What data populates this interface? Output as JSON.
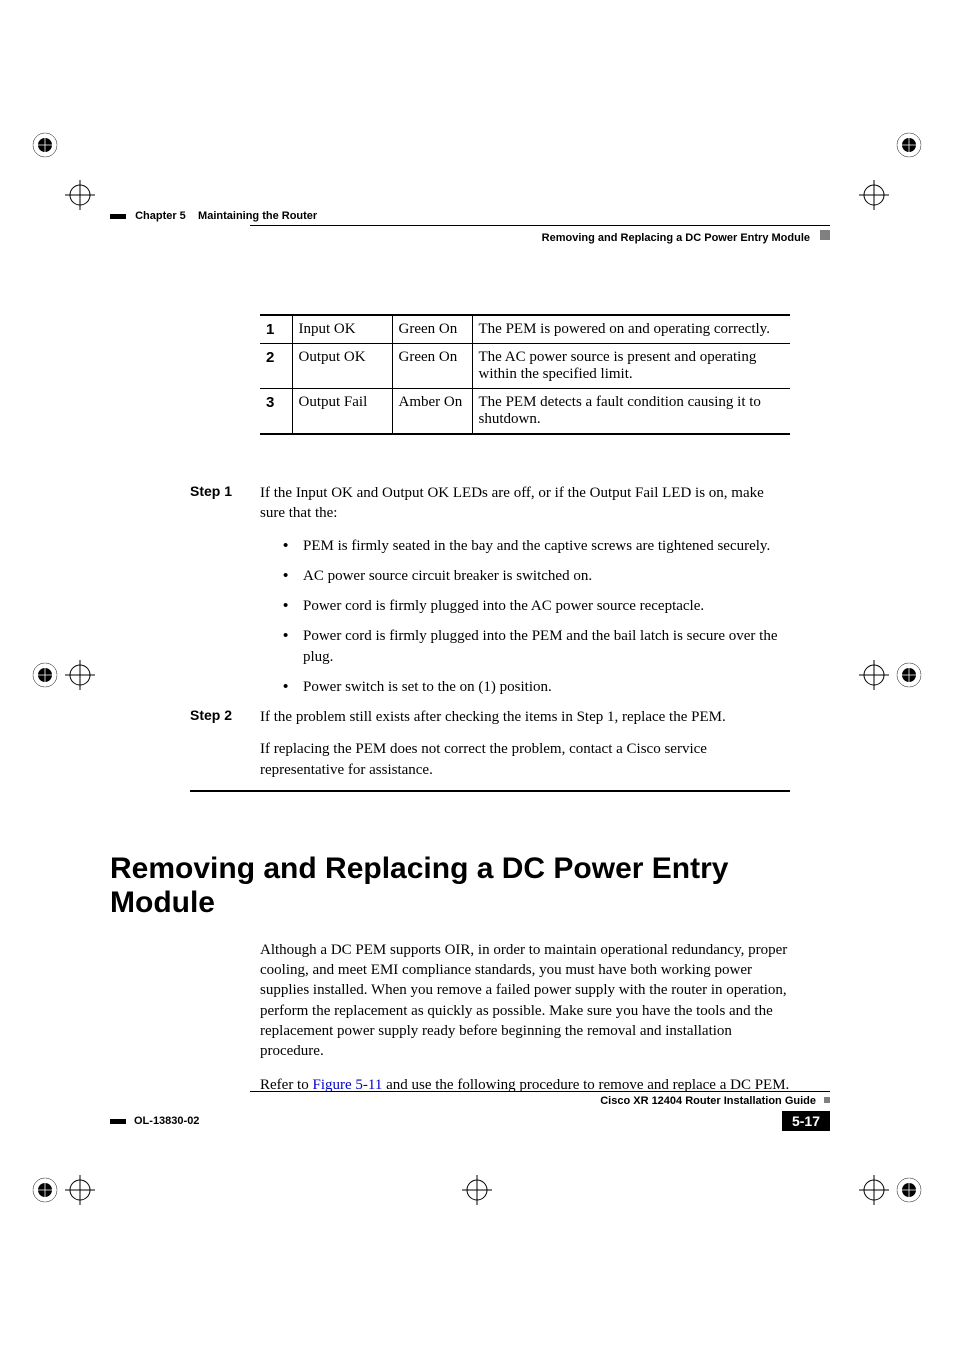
{
  "header": {
    "chapter": "Chapter 5",
    "chapter_title": "Maintaining the Router",
    "section_title": "Removing and Replacing a DC Power Entry Module"
  },
  "table": {
    "rows": [
      {
        "num": "1",
        "name": "Input OK",
        "led": "Green On",
        "desc": "The PEM is powered on and operating correctly."
      },
      {
        "num": "2",
        "name": "Output OK",
        "led": "Green On",
        "desc": "The AC power source is present and operating within the specified limit."
      },
      {
        "num": "3",
        "name": "Output Fail",
        "led": "Amber On",
        "desc": "The PEM detects a fault condition causing it to shutdown."
      }
    ]
  },
  "steps": {
    "step1_label": "Step 1",
    "step1_text": "If the Input OK and Output OK LEDs are off, or if the Output Fail LED is on, make sure that the:",
    "bullets": [
      "PEM is firmly seated in the bay and the captive screws are tightened securely.",
      "AC power source circuit breaker is switched on.",
      "Power cord is firmly plugged into the AC power source receptacle.",
      "Power cord is firmly plugged into the PEM and the bail latch is secure over the plug.",
      "Power switch is set to the on (1) position."
    ],
    "step2_label": "Step 2",
    "step2_text": "If the problem still exists after checking the items in Step 1, replace the PEM.",
    "step2_para": "If replacing the PEM does not correct the problem, contact a Cisco service representative for assistance."
  },
  "section": {
    "heading": "Removing and Replacing a DC Power Entry Module",
    "para1": "Although a DC PEM supports OIR, in order to maintain operational redundancy, proper cooling, and meet EMI compliance standards, you must have both working power supplies installed. When you remove a failed power supply with the router in operation, perform the replacement as quickly as possible. Make sure you have the tools and the replacement power supply ready before beginning the removal and installation procedure.",
    "para2_prefix": "Refer to ",
    "para2_link": "Figure 5-11",
    "para2_suffix": " and use the following procedure to remove and replace a DC PEM."
  },
  "footer": {
    "guide_title": "Cisco XR 12404 Router Installation Guide",
    "doc_id": "OL-13830-02",
    "page_num": "5-17"
  }
}
